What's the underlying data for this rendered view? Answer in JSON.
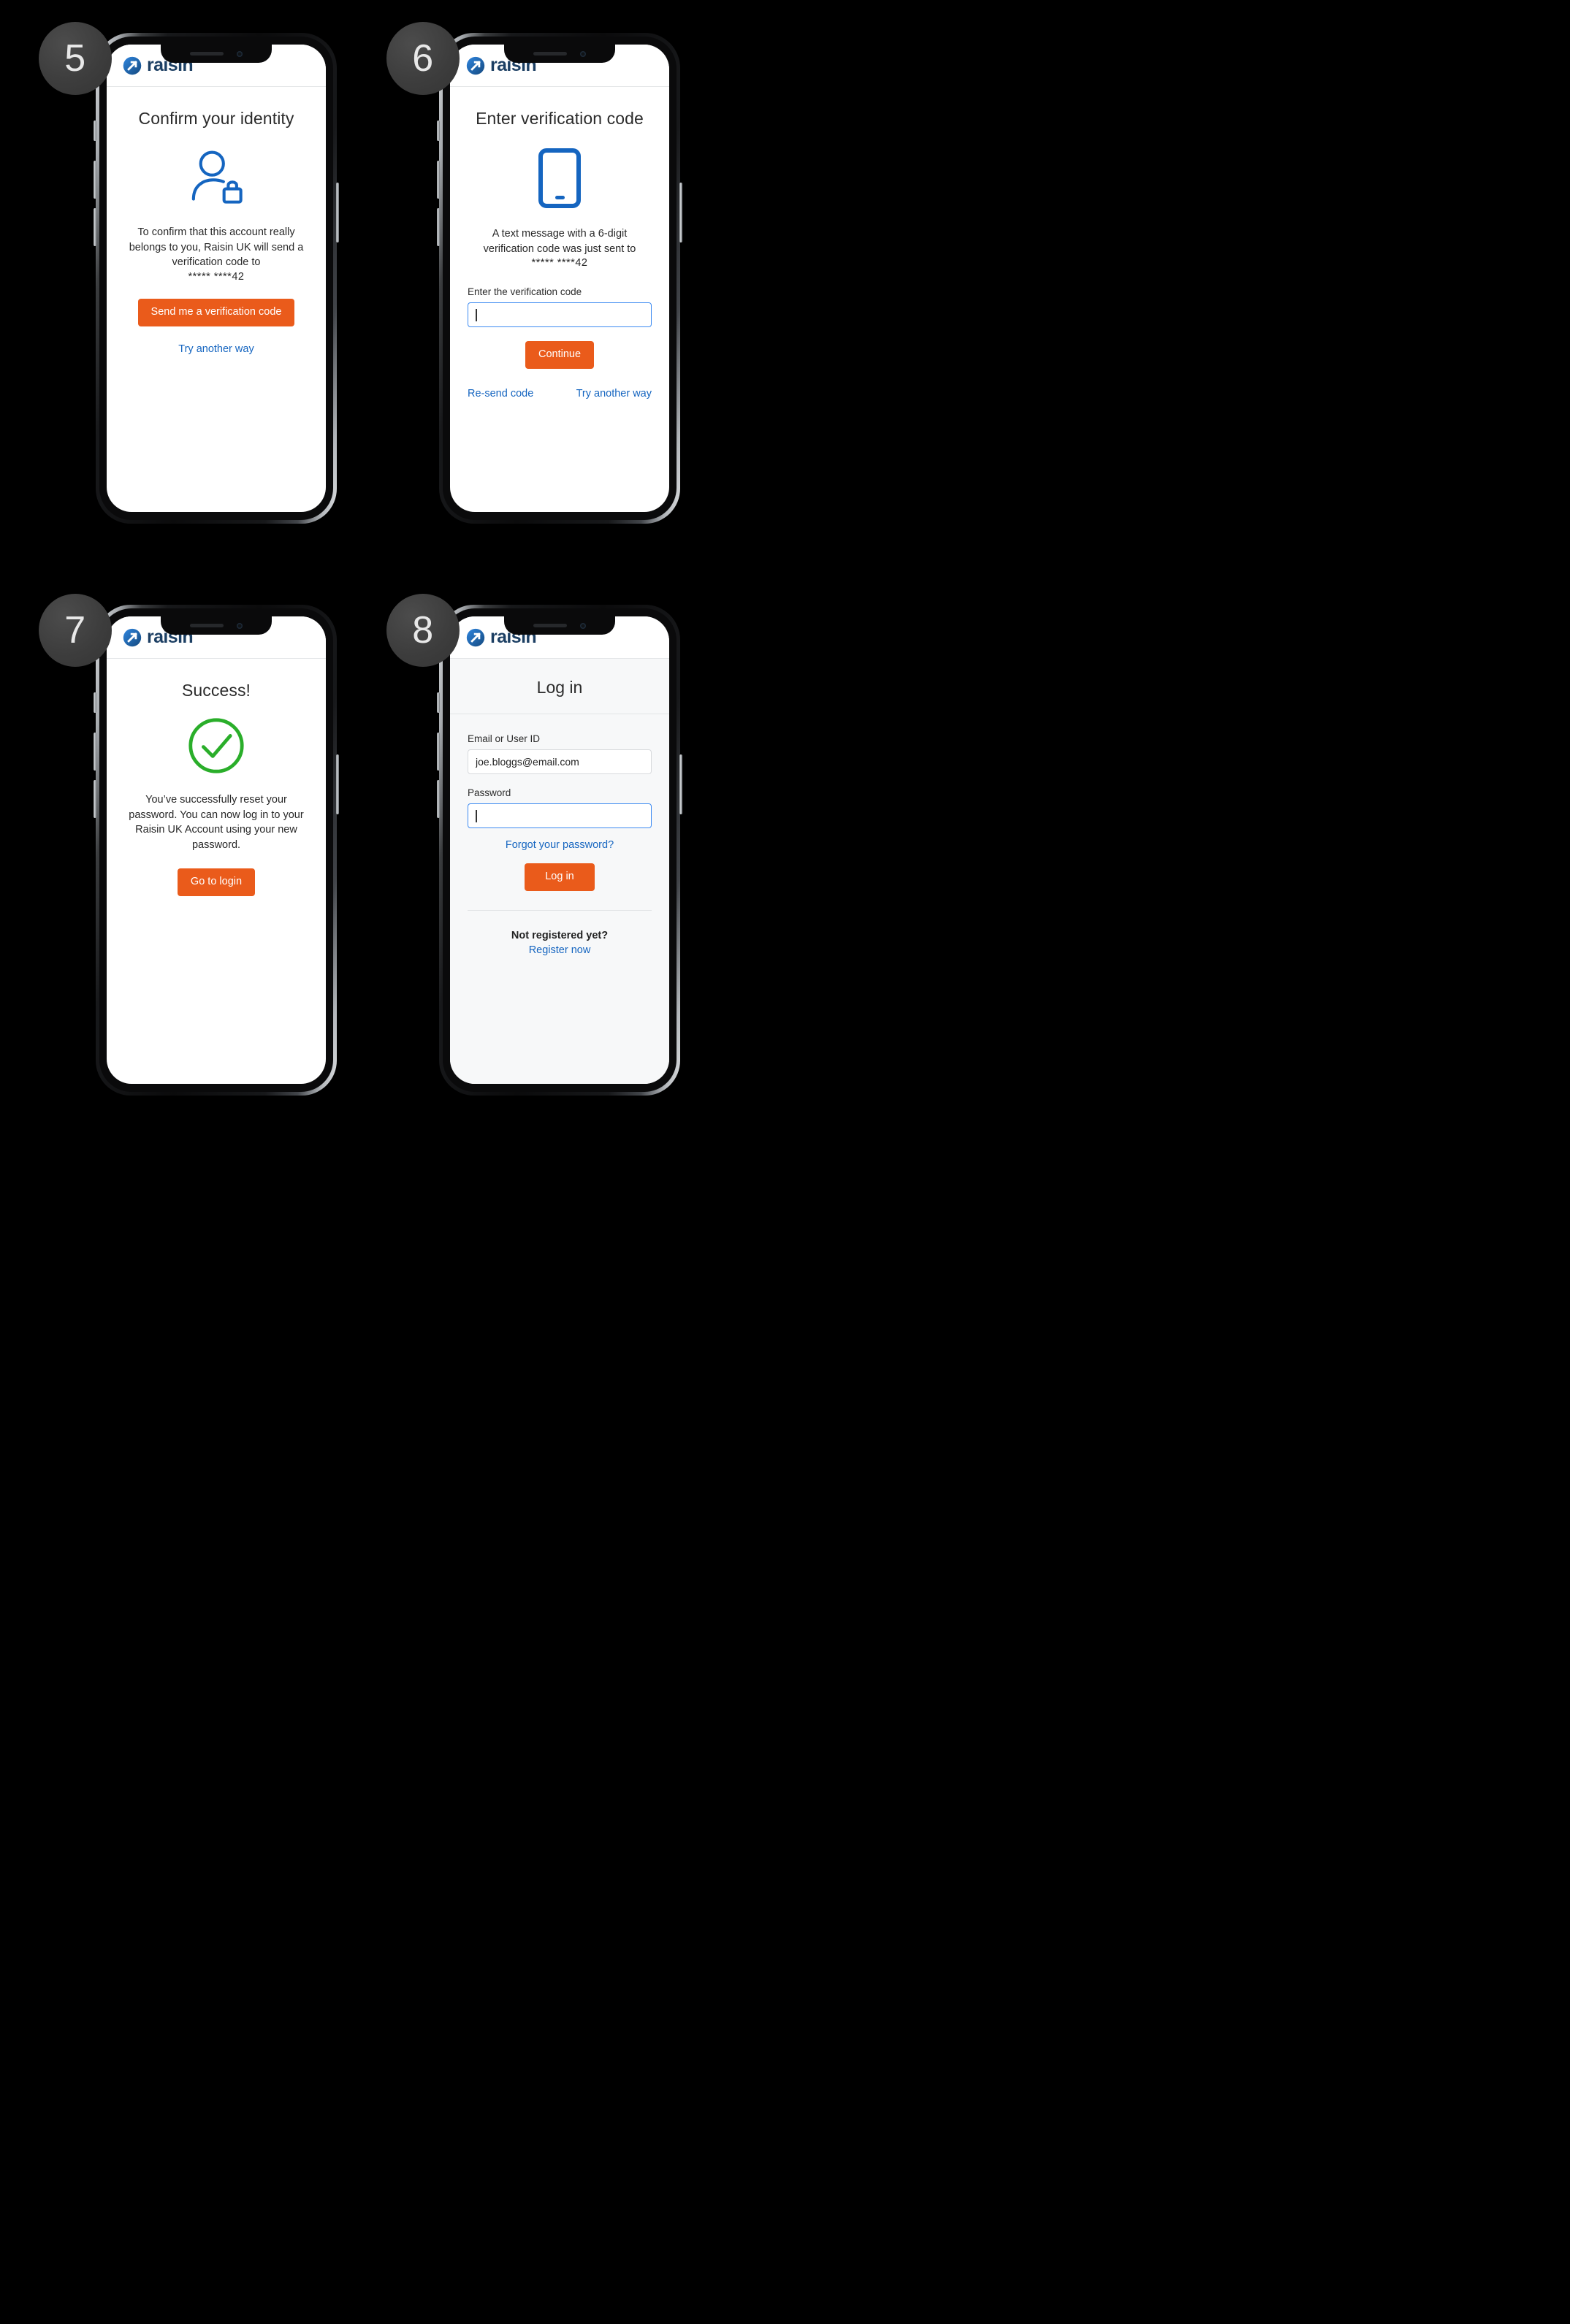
{
  "theme": {
    "accent_orange": "#ea5b1b",
    "link_blue": "#1565c0",
    "icon_blue": "#1565c0",
    "success_green": "#2aae2a",
    "logo_navy": "#1c3f63",
    "background": "#000000"
  },
  "brand": {
    "name": "raisin",
    "logo_icon": "raisin-arrow-logo-icon"
  },
  "steps": [
    {
      "badge": "5",
      "screen_name": "confirm-identity",
      "title": "Confirm your identity",
      "hero_icon": "user-lock-icon",
      "paragraph": "To confirm that this account really belongs to you, Raisin UK will send a verification code to",
      "masked_number": "***** ****42",
      "primary_button": "Send me a verification code",
      "secondary_link": "Try another way"
    },
    {
      "badge": "6",
      "screen_name": "enter-verification-code",
      "title": "Enter verification code",
      "hero_icon": "mobile-phone-icon",
      "paragraph": "A text message with a 6-digit verification code was just sent to",
      "masked_number": "***** ****42",
      "field_label": "Enter the verification code",
      "field_value": "",
      "field_placeholder": "",
      "primary_button": "Continue",
      "left_link": "Re-send code",
      "right_link": "Try another way"
    },
    {
      "badge": "7",
      "screen_name": "password-reset-success",
      "title": "Success!",
      "hero_icon": "check-circle-icon",
      "paragraph": "You’ve successfully reset your password. You can now log in to your Raisin UK Account using your new password.",
      "primary_button": "Go to login"
    },
    {
      "badge": "8",
      "screen_name": "log-in",
      "title": "Log in",
      "email_label": "Email or User ID",
      "email_value": "joe.bloggs@email.com",
      "password_label": "Password",
      "password_value": "",
      "forgot_link": "Forgot your password?",
      "primary_button": "Log in",
      "not_registered_title": "Not registered yet?",
      "register_link": "Register now"
    }
  ]
}
